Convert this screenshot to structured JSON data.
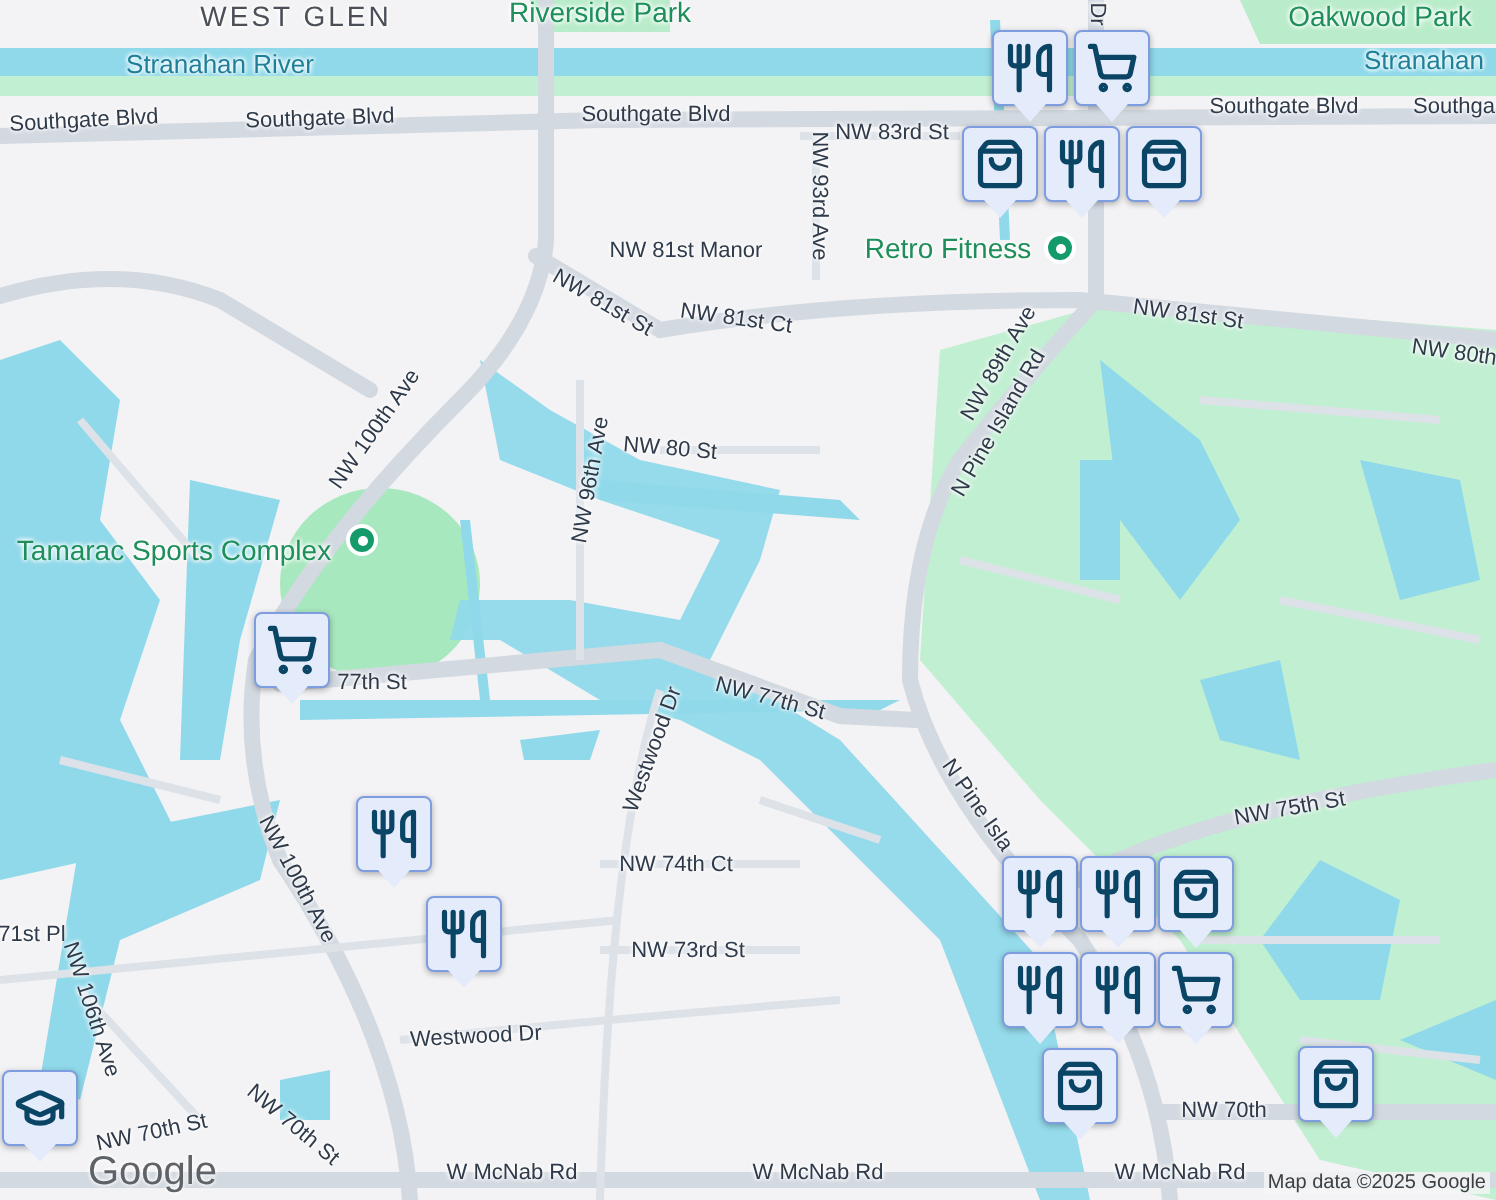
{
  "labels": [
    {
      "text": "WEST GLEN",
      "kind": "district"
    },
    {
      "text": "Riverside Park",
      "kind": "park"
    },
    {
      "text": "Oakwood Park",
      "kind": "park"
    },
    {
      "text": "Stranahan River",
      "kind": "water"
    },
    {
      "text": "Stranahan",
      "kind": "water"
    },
    {
      "text": "Southgate Blvd",
      "kind": "street"
    },
    {
      "text": "Southgate Blvd",
      "kind": "street"
    },
    {
      "text": "Southgate Blvd",
      "kind": "street"
    },
    {
      "text": "Southgate Blvd",
      "kind": "street"
    },
    {
      "text": "Southga",
      "kind": "street"
    },
    {
      "text": "NW 83rd St",
      "kind": "street"
    },
    {
      "text": "NW 93rd Ave",
      "kind": "street"
    },
    {
      "text": "Dr",
      "kind": "street"
    },
    {
      "text": "NW 81st Manor",
      "kind": "street"
    },
    {
      "text": "NW 81st Ct",
      "kind": "street"
    },
    {
      "text": "NW 81st St",
      "kind": "street"
    },
    {
      "text": "NW 81st St",
      "kind": "street"
    },
    {
      "text": "NW 80th",
      "kind": "street"
    },
    {
      "text": "NW 89th Ave",
      "kind": "street"
    },
    {
      "text": "N Pine Island Rd",
      "kind": "street"
    },
    {
      "text": "NW 80 St",
      "kind": "street"
    },
    {
      "text": "NW 96th Ave",
      "kind": "street"
    },
    {
      "text": "NW 100th Ave",
      "kind": "street"
    },
    {
      "text": "Tamarac Sports Complex",
      "kind": "poi"
    },
    {
      "text": "Retro Fitness",
      "kind": "poi"
    },
    {
      "text": "77th St",
      "kind": "street"
    },
    {
      "text": "NW 77th St",
      "kind": "street"
    },
    {
      "text": "Westwood Dr",
      "kind": "street"
    },
    {
      "text": "NW 75th St",
      "kind": "street"
    },
    {
      "text": "N Pine Isla",
      "kind": "street"
    },
    {
      "text": "NW 74th Ct",
      "kind": "street"
    },
    {
      "text": "NW 73rd St",
      "kind": "street"
    },
    {
      "text": "NW 100th Ave",
      "kind": "street"
    },
    {
      "text": "Westwood Dr",
      "kind": "street"
    },
    {
      "text": "71st Pl",
      "kind": "street"
    },
    {
      "text": "NW 106th Ave",
      "kind": "street"
    },
    {
      "text": "NW 70th St",
      "kind": "street"
    },
    {
      "text": "NW 70th St",
      "kind": "street"
    },
    {
      "text": "NW 70th",
      "kind": "street"
    },
    {
      "text": "W McNab Rd",
      "kind": "street"
    },
    {
      "text": "W McNab Rd",
      "kind": "street"
    },
    {
      "text": "W McNab Rd",
      "kind": "street"
    }
  ],
  "markers": [
    {
      "kind": "restaurant"
    },
    {
      "kind": "grocery"
    },
    {
      "kind": "shopping"
    },
    {
      "kind": "restaurant"
    },
    {
      "kind": "shopping"
    },
    {
      "kind": "grocery"
    },
    {
      "kind": "restaurant"
    },
    {
      "kind": "restaurant"
    },
    {
      "kind": "school"
    },
    {
      "kind": "restaurant"
    },
    {
      "kind": "restaurant"
    },
    {
      "kind": "shopping"
    },
    {
      "kind": "restaurant"
    },
    {
      "kind": "restaurant"
    },
    {
      "kind": "grocery"
    },
    {
      "kind": "shopping"
    },
    {
      "kind": "shopping"
    }
  ],
  "logo": "Google",
  "attribution": "Map data ©2025 Google"
}
